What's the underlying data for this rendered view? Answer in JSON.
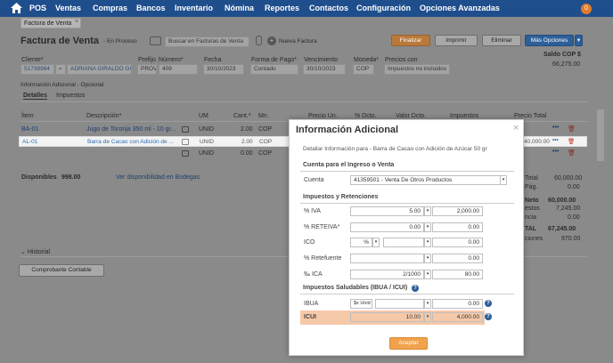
{
  "nav": {
    "items": [
      "POS",
      "Ventas",
      "Compras",
      "Bancos",
      "Inventario",
      "Nómina",
      "Reportes",
      "Contactos",
      "Configuración",
      "Opciones Avanzadas"
    ],
    "badge": "0"
  },
  "tab": {
    "label": "Factura de Venta",
    "close": "×"
  },
  "header": {
    "title": "Factura de Venta",
    "status": "- En Proceso",
    "search_placeholder": "Buscar en Facturas de Venta",
    "new_invoice": "Nueva Factura",
    "finalize": "Finalizar",
    "print": "Imprimir",
    "delete": "Eliminar",
    "more": "Más Opciones",
    "saldo_label": "Saldo COP $",
    "saldo_value": "66,275.00"
  },
  "form": {
    "cliente_label": "Cliente*",
    "cliente_id": "51738984",
    "cliente_name": "ADRIANA GIRALDO GOM",
    "prefijo_label": "Prefijo",
    "prefijo_value": "PROV",
    "numero_label": "Número*",
    "numero_value": "409",
    "fecha_label": "Fecha",
    "fecha_value": "30/10/2023",
    "forma_label": "Forma de Pago*",
    "forma_value": "Contado",
    "venc_label": "Vencimiento",
    "venc_value": "30/10/2023",
    "moneda_label": "Moneda*",
    "moneda_value": "COP",
    "precios_label": "Precios con",
    "precios_value": "Impuestos no incluidos",
    "info_adicional": "Información Adicional - Opcional",
    "subtab_detalles": "Detalles",
    "subtab_impuestos": "Impuestos"
  },
  "table": {
    "headers": [
      "Ítem",
      "Descripción*",
      "UM",
      "Cant.*",
      "Mn.",
      "Precio Un.",
      "% Dcto.",
      "Valor Dcto.",
      "Impuestos",
      "Precio Total"
    ],
    "rows": [
      {
        "item": "BA-01",
        "desc": "Jugo de Toronja 350 ml - 10 gr...",
        "um": "UNID",
        "cant": "2.00",
        "mn": "COP"
      },
      {
        "item": "AL-01",
        "desc": "Barra de Cacao con Adición de ...",
        "um": "UNID",
        "cant": "2.00",
        "mn": "COP",
        "total": "40,000.00"
      },
      {
        "item": "",
        "desc": "",
        "um": "UNID",
        "cant": "0.00",
        "mn": "COP"
      }
    ]
  },
  "footer": {
    "disponibles_label": "Disponibles",
    "disponibles_value": "998.00",
    "ver_disp": "Ver disponibilidad en Bodegas",
    "historial": "Historial",
    "comprobante": "Comprobante Contable",
    "totals": [
      {
        "label": "Total",
        "value": "60,000.00"
      },
      {
        "label": "Pág.",
        "value": "0.00"
      },
      {
        "label": "Neto",
        "value": "60,000.00"
      },
      {
        "label": "estos",
        "value": "7,245.00"
      },
      {
        "label": "ncia",
        "value": "0.00"
      },
      {
        "label": "TAL",
        "value": "67,245.00"
      },
      {
        "label": "ciones",
        "value": "970.00"
      }
    ]
  },
  "modal": {
    "title": "Información Adicional",
    "close": "×",
    "subtitle": "Detallar Información para - Barra de Cacao con Adición de Azúcar 50 gr",
    "sec_cuenta": "Cuenta para el Ingreso o Venta",
    "cuenta_label": "Cuenta",
    "cuenta_value": "41359501 - Venta De Otros Productos",
    "sec_impuestos": "Impuestos y Retenciones",
    "iva_label": "% IVA",
    "iva_pct": "5.00",
    "iva_value": "2,000.00",
    "reteiva_label": "% RETEIVA*",
    "reteiva_pct": "0.00",
    "reteiva_value": "0.00",
    "ico_label": "ICO",
    "ico_unit": "%",
    "ico_value": "0.00",
    "retefuente_label": "% Retefuente",
    "retefuente_value": "0.00",
    "ica_label": "‰ ICA",
    "ica_pct": "2/1000",
    "ica_value": "80.00",
    "sec_saludables": "Impuestos Saludables (IBUA / ICUI)",
    "ibua_label": "IBUA",
    "ibua_unit": "$x Unid",
    "ibua_value": "0.00",
    "icui_label": "ICUI",
    "icui_pct": "10.00",
    "icui_value": "4,000.00",
    "accept": "Aceptar"
  }
}
